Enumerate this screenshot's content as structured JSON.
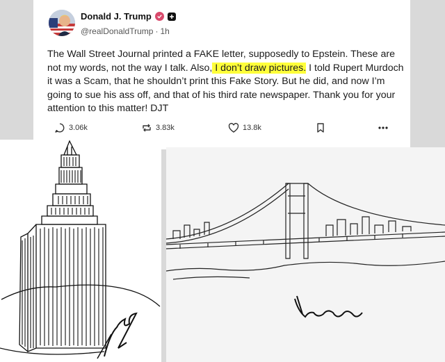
{
  "post": {
    "display_name": "Donald J. Trump",
    "handle": "@realDonaldTrump",
    "separator": "·",
    "time": "1h",
    "text_before_highlight": "The Wall Street Journal printed a FAKE letter, supposedly to Epstein. These are not my words, not the way I talk. Also,",
    "text_highlight": " I don’t draw pictures.",
    "text_after_highlight": " I told Rupert Murdoch it was a Scam, that he shouldn’t print this Fake Story. But he did, and now I’m going to sue his ass off, and that of his third rate newspaper. Thank you for your attention to this matter!  DJT",
    "highlight_color": "#ffff3a",
    "verified_color": "#d94a6c"
  },
  "actions": {
    "replies": "3.06k",
    "reposts": "3.83k",
    "likes": "13.8k"
  },
  "icons": [
    "reply-icon",
    "repost-icon",
    "like-icon",
    "bookmark-icon",
    "more-icon",
    "verified-icon",
    "plus-badge-icon"
  ],
  "images": {
    "left": "sketch-empire-state-building",
    "right": "sketch-george-washington-bridge"
  }
}
